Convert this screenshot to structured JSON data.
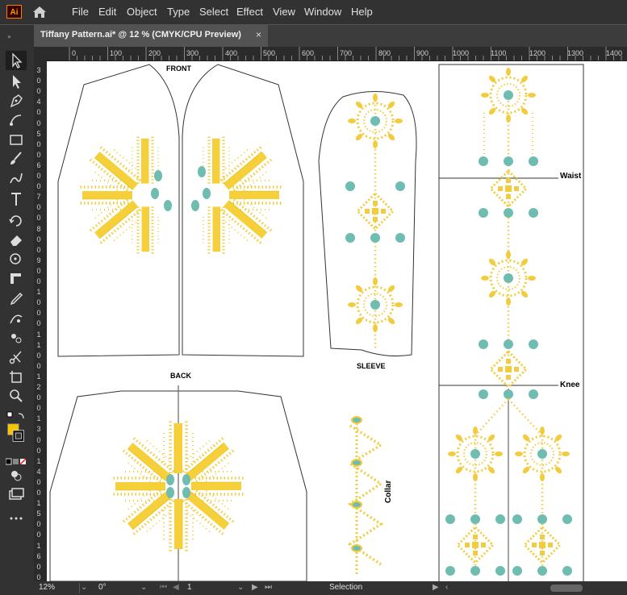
{
  "app": {
    "logo_text": "Ai"
  },
  "menu": [
    "File",
    "Edit",
    "Object",
    "Type",
    "Select",
    "Effect",
    "View",
    "Window",
    "Help"
  ],
  "document_tab": {
    "title": "Tiffany Pattern.ai* @ 12 % (CMYK/CPU Preview)",
    "close": "×"
  },
  "ruler": {
    "top": [
      "0",
      "100",
      "200",
      "300",
      "400",
      "500",
      "600",
      "700",
      "800",
      "900",
      "1000",
      "1100",
      "1200",
      "1300",
      "1400"
    ],
    "left": [
      "3",
      "0",
      "0",
      "4",
      "0",
      "0",
      "5",
      "0",
      "0",
      "6",
      "0",
      "0",
      "7",
      "0",
      "0",
      "8",
      "0",
      "0",
      "9",
      "0",
      "0",
      "1",
      "0",
      "0",
      "0",
      "1",
      "1",
      "0",
      "0",
      "1",
      "2",
      "0",
      "0",
      "1",
      "3",
      "0",
      "0",
      "1",
      "4",
      "0",
      "0",
      "1",
      "5",
      "0",
      "0",
      "1",
      "6",
      "0",
      "0"
    ]
  },
  "canvas": {
    "front_label": "FRONT",
    "back_label": "BACK",
    "sleeve_label": "SLEEVE",
    "collar_label": "Collar",
    "waist_label": "Waist",
    "knee_label": "Knee"
  },
  "status": {
    "zoom": "12%",
    "rotation": "0°",
    "artboard": "1",
    "tool": "Selection"
  },
  "colors": {
    "gold": "#f2cc3d",
    "teal": "#6fbdb0",
    "accent_fill": "#f5c400"
  }
}
